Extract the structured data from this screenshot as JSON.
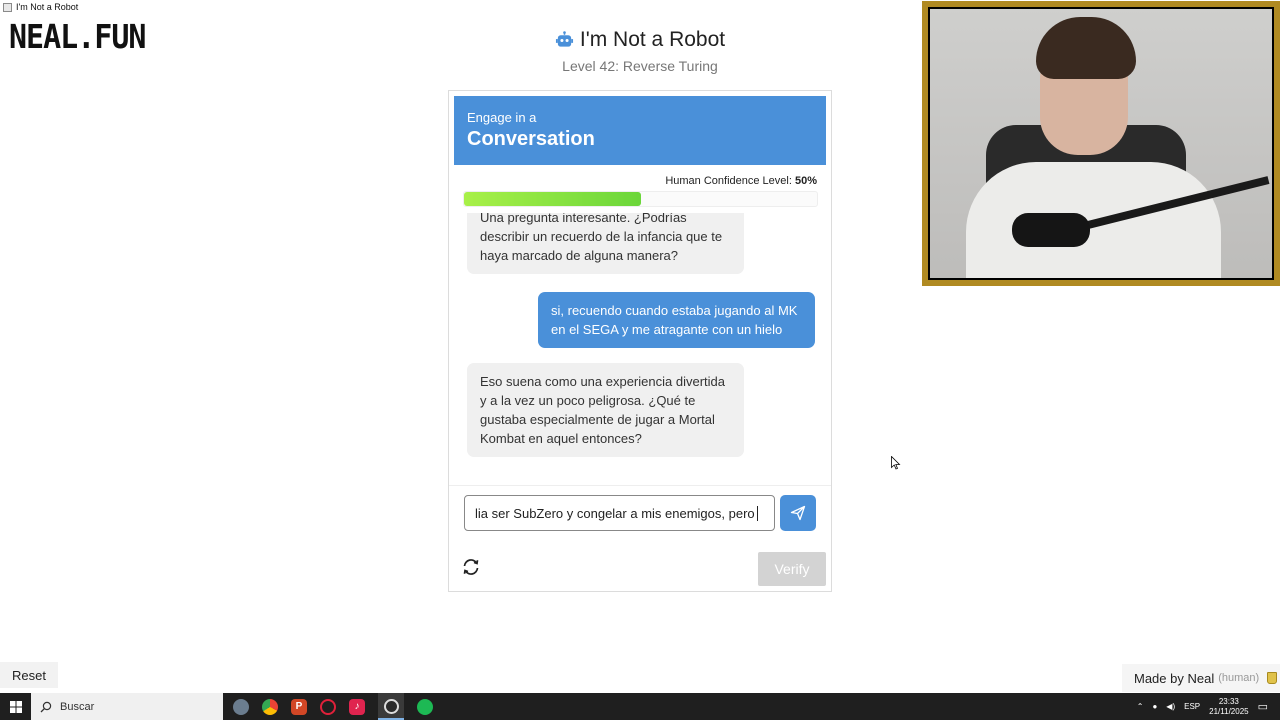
{
  "window": {
    "title": "I'm Not a Robot"
  },
  "site": {
    "logo": "NEAL.FUN"
  },
  "header": {
    "title": "I'm Not a Robot",
    "level": "Level 42: Reverse Turing"
  },
  "challenge": {
    "prompt_small": "Engage in a",
    "prompt_large": "Conversation",
    "confidence_label": "Human Confidence Level:",
    "confidence_value": "50%",
    "confidence_fraction": 0.5
  },
  "messages": [
    {
      "role": "bot",
      "text": "Una pregunta interesante. ¿Podrías describir un recuerdo de la infancia que te haya marcado de alguna manera?"
    },
    {
      "role": "user",
      "text": "si, recuendo cuando estaba jugando al MK en el SEGA y me atragante con un hielo"
    },
    {
      "role": "bot",
      "text": "Eso suena como una experiencia divertida y a la vez un poco peligrosa. ¿Qué te gustaba especialmente de jugar a Mortal Kombat en aquel entonces?"
    }
  ],
  "composer": {
    "value": "lia ser SubZero y congelar a mis enemigos, pero"
  },
  "actions": {
    "verify_label": "Verify",
    "reset_label": "Reset"
  },
  "footer": {
    "made_by": "Made by Neal",
    "made_by_tag": "(human)"
  },
  "taskbar": {
    "search_placeholder": "Buscar",
    "language": "ESP",
    "time": "23:33",
    "date": "21/11/2025",
    "apps": [
      "browser-app-icon",
      "chrome-icon",
      "powerpoint-icon",
      "opera-icon",
      "tiktok-icon",
      "obs-icon",
      "spotify-icon"
    ]
  },
  "colors": {
    "accent": "#4a90d9",
    "progress": "#7ee040",
    "webcam_frame": "#b08a22"
  }
}
